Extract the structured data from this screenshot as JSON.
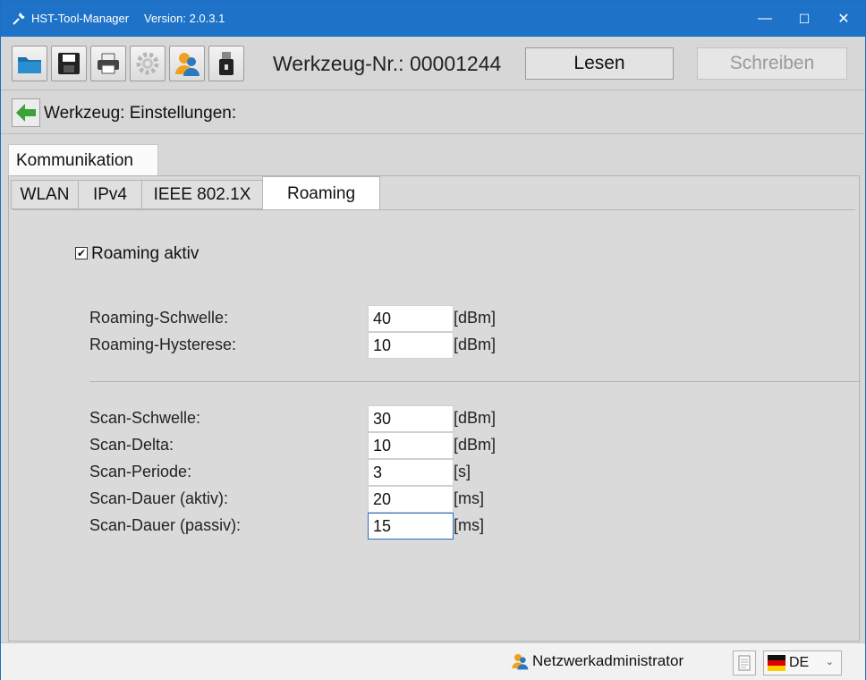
{
  "window": {
    "app_title": "HST-Tool-Manager",
    "version": "Version: 2.0.3.1",
    "minimize": "—",
    "maximize": "☐",
    "close": "✕"
  },
  "toolbar": {
    "tool_number": "Werkzeug-Nr.: 00001244",
    "read_label": "Lesen",
    "write_label": "Schreiben",
    "icons": [
      "folder-icon",
      "save-icon",
      "print-icon",
      "settings-icon",
      "user-icon",
      "usb-icon"
    ]
  },
  "breadcrumb": {
    "text": "Werkzeug: Einstellungen:"
  },
  "main_tab": {
    "label": "Kommunikation"
  },
  "subtabs": [
    {
      "label": "WLAN"
    },
    {
      "label": "IPv4"
    },
    {
      "label": "IEEE 802.1X"
    },
    {
      "label": "Roaming",
      "active": true
    }
  ],
  "roaming": {
    "enabled_label": "Roaming aktiv",
    "enabled": true,
    "group1": [
      {
        "label": "Roaming-Schwelle:",
        "value": "40",
        "unit": "[dBm]"
      },
      {
        "label": "Roaming-Hysterese:",
        "value": "10",
        "unit": "[dBm]"
      }
    ],
    "group2": [
      {
        "label": "Scan-Schwelle:",
        "value": "30",
        "unit": "[dBm]"
      },
      {
        "label": "Scan-Delta:",
        "value": "10",
        "unit": "[dBm]"
      },
      {
        "label": "Scan-Periode:",
        "value": "3",
        "unit": "[s]"
      },
      {
        "label": "Scan-Dauer (aktiv):",
        "value": "20",
        "unit": "[ms]"
      },
      {
        "label": "Scan-Dauer (passiv):",
        "value": "15",
        "unit": "[ms]",
        "focused": true
      }
    ]
  },
  "status": {
    "user_role": "Netzwerkadministrator",
    "language": "DE"
  },
  "colors": {
    "titlebar": "#1e73c8",
    "accent_green": "#3aa23a",
    "focus_border": "#2a6ec5"
  }
}
